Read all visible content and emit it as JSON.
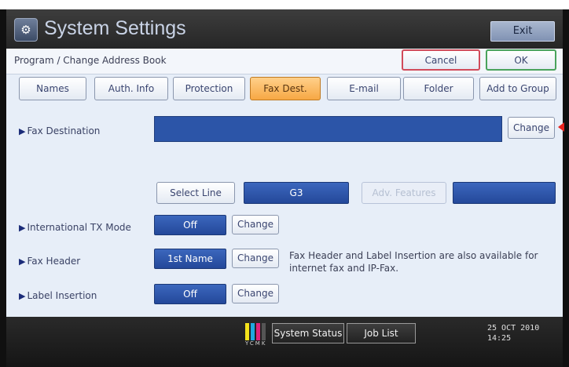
{
  "header": {
    "title": "System Settings",
    "exit_label": "Exit"
  },
  "subheader": {
    "breadcrumb": "Program / Change Address Book",
    "cancel_label": "Cancel",
    "ok_label": "OK"
  },
  "tabs": [
    {
      "label": "Names"
    },
    {
      "label": "Auth. Info"
    },
    {
      "label": "Protection"
    },
    {
      "label": "Fax Dest.",
      "active": true
    },
    {
      "label": "E-mail"
    },
    {
      "label": "Folder"
    },
    {
      "label": "Add to Group"
    }
  ],
  "fax_destination": {
    "label": "Fax Destination",
    "value": "",
    "change_label": "Change"
  },
  "line": {
    "select_label": "Select Line",
    "current": "G3",
    "adv_features_label": "Adv. Features"
  },
  "international_tx": {
    "label": "International TX Mode",
    "value": "Off",
    "change_label": "Change"
  },
  "fax_header": {
    "label": "Fax Header",
    "value": "1st Name",
    "change_label": "Change",
    "note": "Fax Header and Label Insertion are also available for internet fax and IP-Fax."
  },
  "label_insertion": {
    "label": "Label Insertion",
    "value": "Off",
    "change_label": "Change"
  },
  "footer": {
    "toner_letters": "YCMK",
    "system_status_label": "System Status",
    "job_list_label": "Job List",
    "date": "25 OCT  2010",
    "time": "14:25"
  },
  "colors": {
    "accent_blue": "#2c55a8",
    "active_tab": "#f7a844",
    "cancel_border": "#d14b5a",
    "ok_border": "#4aa35c",
    "toner": [
      "#f4e21b",
      "#1ea9e0",
      "#e0237a",
      "#222222"
    ]
  },
  "icons": {
    "app": "system-settings-icon",
    "triangle": "triangle-right-icon"
  }
}
